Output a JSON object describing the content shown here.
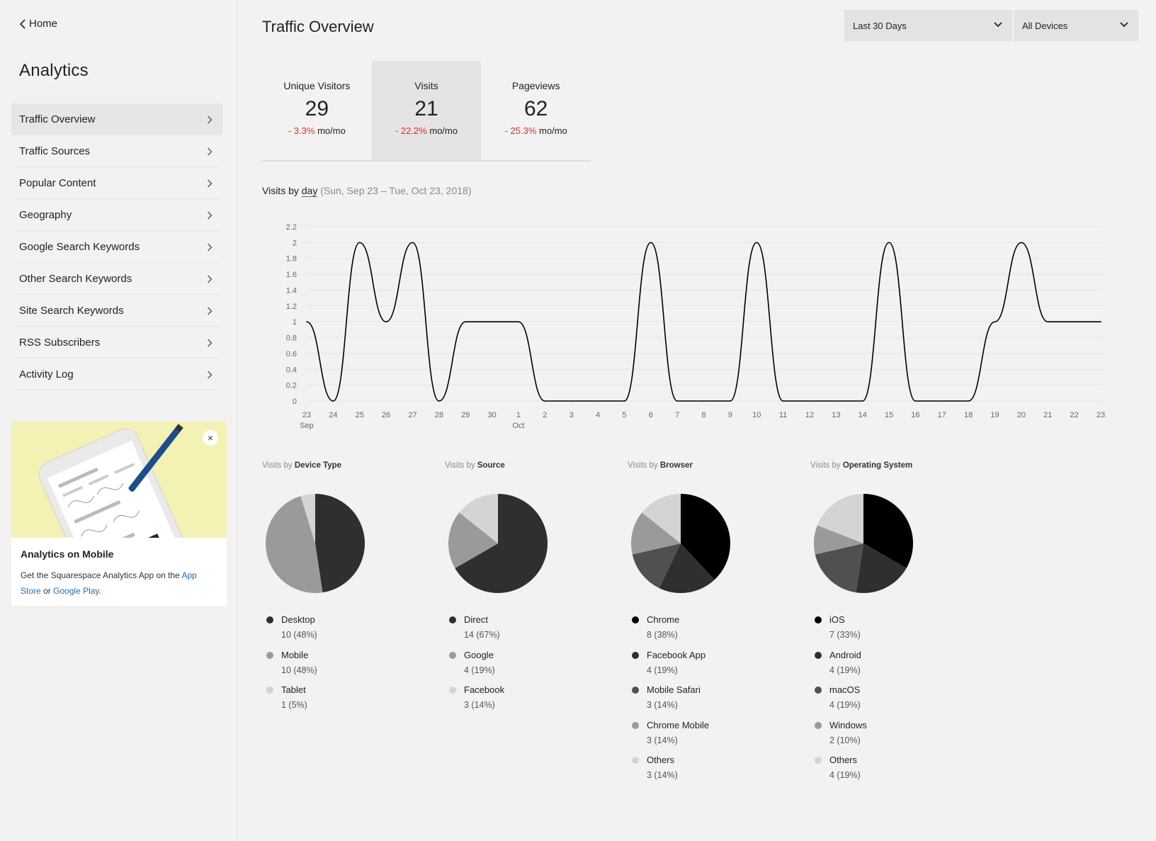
{
  "sidebar": {
    "back_label": "Home",
    "title": "Analytics",
    "items": [
      {
        "label": "Traffic Overview",
        "active": true
      },
      {
        "label": "Traffic Sources"
      },
      {
        "label": "Popular Content"
      },
      {
        "label": "Geography"
      },
      {
        "label": "Google Search Keywords"
      },
      {
        "label": "Other Search Keywords"
      },
      {
        "label": "Site Search Keywords"
      },
      {
        "label": "RSS Subscribers"
      },
      {
        "label": "Activity Log"
      }
    ],
    "promo": {
      "title": "Analytics on Mobile",
      "body_prefix": "Get the Squarespace Analytics App on the",
      "app_store": "App Store",
      "connector": "or",
      "google_play": "Google Play",
      "suffix": ".",
      "close_icon": "×"
    }
  },
  "header": {
    "title": "Traffic Overview",
    "range_dropdown": "Last 30 Days",
    "device_dropdown": "All Devices"
  },
  "metrics": [
    {
      "label": "Unique Visitors",
      "value": "29",
      "change": "- 3.3%",
      "suffix": "mo/mo"
    },
    {
      "label": "Visits",
      "value": "21",
      "change": "- 22.2%",
      "suffix": "mo/mo",
      "active": true
    },
    {
      "label": "Pageviews",
      "value": "62",
      "change": "- 25.3%",
      "suffix": "mo/mo"
    }
  ],
  "chart_heading": {
    "prefix": "Visits by",
    "unit": "day",
    "range": "(Sun, Sep 23 – Tue, Oct 23, 2018)"
  },
  "chart_data": [
    {
      "type": "line",
      "title": "Visits by day",
      "x": [
        "23",
        "24",
        "25",
        "26",
        "27",
        "28",
        "29",
        "30",
        "1",
        "2",
        "3",
        "4",
        "5",
        "6",
        "7",
        "8",
        "9",
        "10",
        "11",
        "12",
        "13",
        "14",
        "15",
        "16",
        "17",
        "18",
        "19",
        "20",
        "21",
        "22",
        "23"
      ],
      "x_sublabels": {
        "0": "Sep",
        "8": "Oct"
      },
      "series": [
        {
          "values": [
            1,
            0,
            2,
            1,
            2,
            0,
            1,
            1,
            1,
            0,
            0,
            0,
            0,
            2,
            0,
            0,
            0,
            2,
            0,
            0,
            0,
            0,
            2,
            0,
            0,
            0,
            1,
            2,
            1,
            1,
            1
          ]
        }
      ],
      "ylim": [
        0,
        2.2
      ],
      "yticks": [
        "0",
        "0.2",
        "0.4",
        "0.6",
        "0.8",
        "1",
        "1.2",
        "1.4",
        "1.6",
        "1.8",
        "2",
        "2.2"
      ],
      "grid": true,
      "color": "#000000"
    },
    {
      "type": "pie",
      "title_prefix": "Visits by",
      "title": "Device Type",
      "slices": [
        {
          "name": "Desktop",
          "value": 10,
          "label": "10 (48%)",
          "color": "#2f2f2f"
        },
        {
          "name": "Mobile",
          "value": 10,
          "label": "10 (48%)",
          "color": "#9a9a9a"
        },
        {
          "name": "Tablet",
          "value": 1,
          "label": "1 (5%)",
          "color": "#d4d4d4"
        }
      ]
    },
    {
      "type": "pie",
      "title_prefix": "Visits by",
      "title": "Source",
      "slices": [
        {
          "name": "Direct",
          "value": 14,
          "label": "14 (67%)",
          "color": "#2f2f2f"
        },
        {
          "name": "Google",
          "value": 4,
          "label": "4 (19%)",
          "color": "#9a9a9a"
        },
        {
          "name": "Facebook",
          "value": 3,
          "label": "3 (14%)",
          "color": "#d4d4d4"
        }
      ]
    },
    {
      "type": "pie",
      "title_prefix": "Visits by",
      "title": "Browser",
      "slices": [
        {
          "name": "Chrome",
          "value": 8,
          "label": "8 (38%)",
          "color": "#000000"
        },
        {
          "name": "Facebook App",
          "value": 4,
          "label": "4 (19%)",
          "color": "#2f2f2f"
        },
        {
          "name": "Mobile Safari",
          "value": 3,
          "label": "3 (14%)",
          "color": "#505050"
        },
        {
          "name": "Chrome Mobile",
          "value": 3,
          "label": "3 (14%)",
          "color": "#9a9a9a"
        },
        {
          "name": "Others",
          "value": 3,
          "label": "3 (14%)",
          "color": "#d4d4d4"
        }
      ]
    },
    {
      "type": "pie",
      "title_prefix": "Visits by",
      "title": "Operating System",
      "slices": [
        {
          "name": "iOS",
          "value": 7,
          "label": "7 (33%)",
          "color": "#000000"
        },
        {
          "name": "Android",
          "value": 4,
          "label": "4 (19%)",
          "color": "#2f2f2f"
        },
        {
          "name": "macOS",
          "value": 4,
          "label": "4 (19%)",
          "color": "#505050"
        },
        {
          "name": "Windows",
          "value": 2,
          "label": "2 (10%)",
          "color": "#9a9a9a"
        },
        {
          "name": "Others",
          "value": 4,
          "label": "4 (19%)",
          "color": "#d4d4d4"
        }
      ]
    }
  ]
}
